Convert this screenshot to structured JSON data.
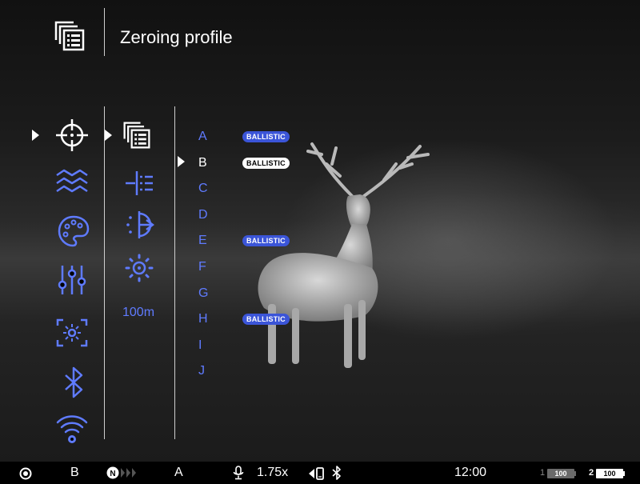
{
  "header": {
    "title": "Zeroing profile",
    "icon": "zeroing-profile-icon"
  },
  "main_menu": {
    "items": [
      {
        "icon": "crosshair-icon",
        "selected": true
      },
      {
        "icon": "calibration-waves-icon"
      },
      {
        "icon": "palette-icon"
      },
      {
        "icon": "sliders-icon"
      },
      {
        "icon": "brightness-frame-icon"
      },
      {
        "icon": "bluetooth-icon"
      },
      {
        "icon": "wifi-settings-icon"
      }
    ]
  },
  "sub_menu": {
    "items": [
      {
        "icon": "zeroing-profile-icon",
        "selected": true
      },
      {
        "icon": "reticle-settings-icon"
      },
      {
        "icon": "zeroing-distance-icon"
      },
      {
        "icon": "sight-brightness-icon"
      }
    ],
    "distance": "100m"
  },
  "profiles": [
    {
      "letter": "A",
      "badge": "BALLISTIC",
      "active": false
    },
    {
      "letter": "B",
      "badge": "BALLISTIC",
      "active": true
    },
    {
      "letter": "C",
      "badge": null,
      "active": false
    },
    {
      "letter": "D",
      "badge": null,
      "active": false
    },
    {
      "letter": "E",
      "badge": "BALLISTIC",
      "active": false
    },
    {
      "letter": "F",
      "badge": null,
      "active": false
    },
    {
      "letter": "G",
      "badge": null,
      "active": false
    },
    {
      "letter": "H",
      "badge": "BALLISTIC",
      "active": false
    },
    {
      "letter": "I",
      "badge": null,
      "active": false
    },
    {
      "letter": "J",
      "badge": null,
      "active": false
    }
  ],
  "status_bar": {
    "mode_icon": "record-icon",
    "profile": "B",
    "nuc_badge": "N",
    "calibration_mode": "A",
    "mic_icon": "microphone-icon",
    "zoom": "1.75x",
    "icons": [
      "speaker-phone-icon",
      "bluetooth-icon"
    ],
    "time": "12:00",
    "battery1_label": "1",
    "battery1_value": "100",
    "battery2_label": "2",
    "battery2_value": "100"
  },
  "colors": {
    "accent": "#5f7bff",
    "badge_bg": "#3b55d8",
    "active": "#ffffff",
    "background": "#000000"
  }
}
